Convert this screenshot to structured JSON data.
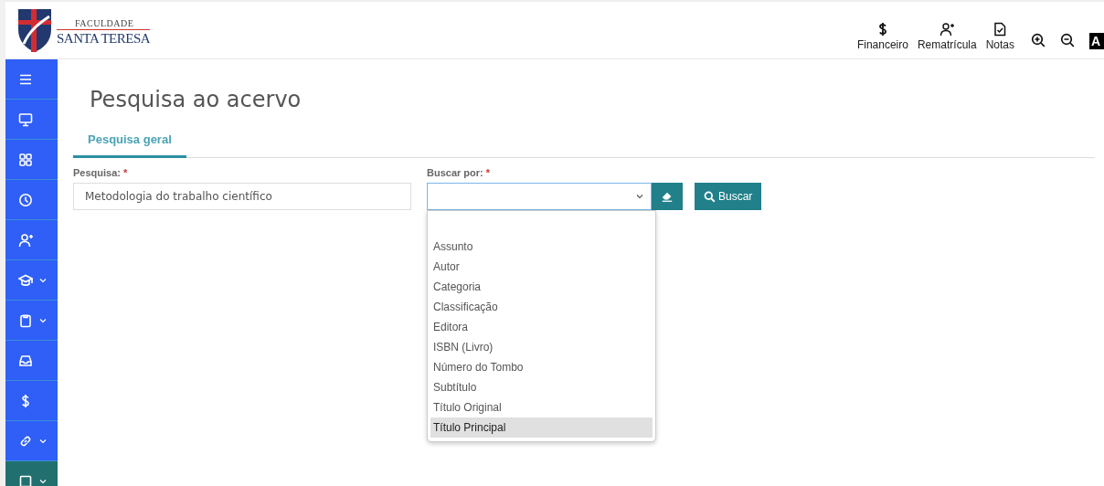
{
  "header": {
    "logo": {
      "top": "FACULDADE",
      "bottom": "SANTA TERESA"
    },
    "nav": [
      {
        "kind": "dollar",
        "label": "Financeiro"
      },
      {
        "kind": "user-plus",
        "label": "Rematrícula"
      },
      {
        "kind": "file-check",
        "label": "Notas"
      }
    ],
    "tools": [
      {
        "kind": "zoom-in"
      },
      {
        "kind": "zoom-out"
      },
      {
        "kind": "letter",
        "text": "A"
      }
    ]
  },
  "sidebar": {
    "items": [
      {
        "kind": "menu",
        "expandable": false,
        "selected": false
      },
      {
        "kind": "monitor",
        "expandable": false,
        "selected": false
      },
      {
        "kind": "grid",
        "expandable": false,
        "selected": false
      },
      {
        "kind": "clock",
        "expandable": false,
        "selected": false
      },
      {
        "kind": "user-plus",
        "expandable": false,
        "selected": false
      },
      {
        "kind": "cap",
        "expandable": true,
        "selected": false
      },
      {
        "kind": "clipboard",
        "expandable": true,
        "selected": false
      },
      {
        "kind": "inbox",
        "expandable": false,
        "selected": false
      },
      {
        "kind": "dollar",
        "expandable": false,
        "selected": false
      },
      {
        "kind": "link",
        "expandable": true,
        "selected": false
      },
      {
        "kind": "square",
        "expandable": true,
        "selected": true
      }
    ]
  },
  "page": {
    "title": "Pesquisa ao acervo",
    "tabs": [
      {
        "label": "Pesquisa geral",
        "selected": true
      }
    ],
    "search": {
      "label": "Pesquisa:",
      "required": "*",
      "value": "Metodologia do trabalho científico"
    },
    "search_by": {
      "label": "Buscar por:",
      "required": "*",
      "expanded": true,
      "options": [
        {
          "label": "Assunto",
          "selected": false
        },
        {
          "label": "Autor",
          "selected": false
        },
        {
          "label": "Categoria",
          "selected": false
        },
        {
          "label": "Classificação",
          "selected": false
        },
        {
          "label": "Editora",
          "selected": false
        },
        {
          "label": "ISBN (Livro)",
          "selected": false
        },
        {
          "label": "Número do Tombo",
          "selected": false
        },
        {
          "label": "Subtítulo",
          "selected": false
        },
        {
          "label": "Título Original",
          "selected": false
        },
        {
          "label": "Título Principal",
          "selected": true
        }
      ]
    },
    "search_button": "Buscar"
  }
}
